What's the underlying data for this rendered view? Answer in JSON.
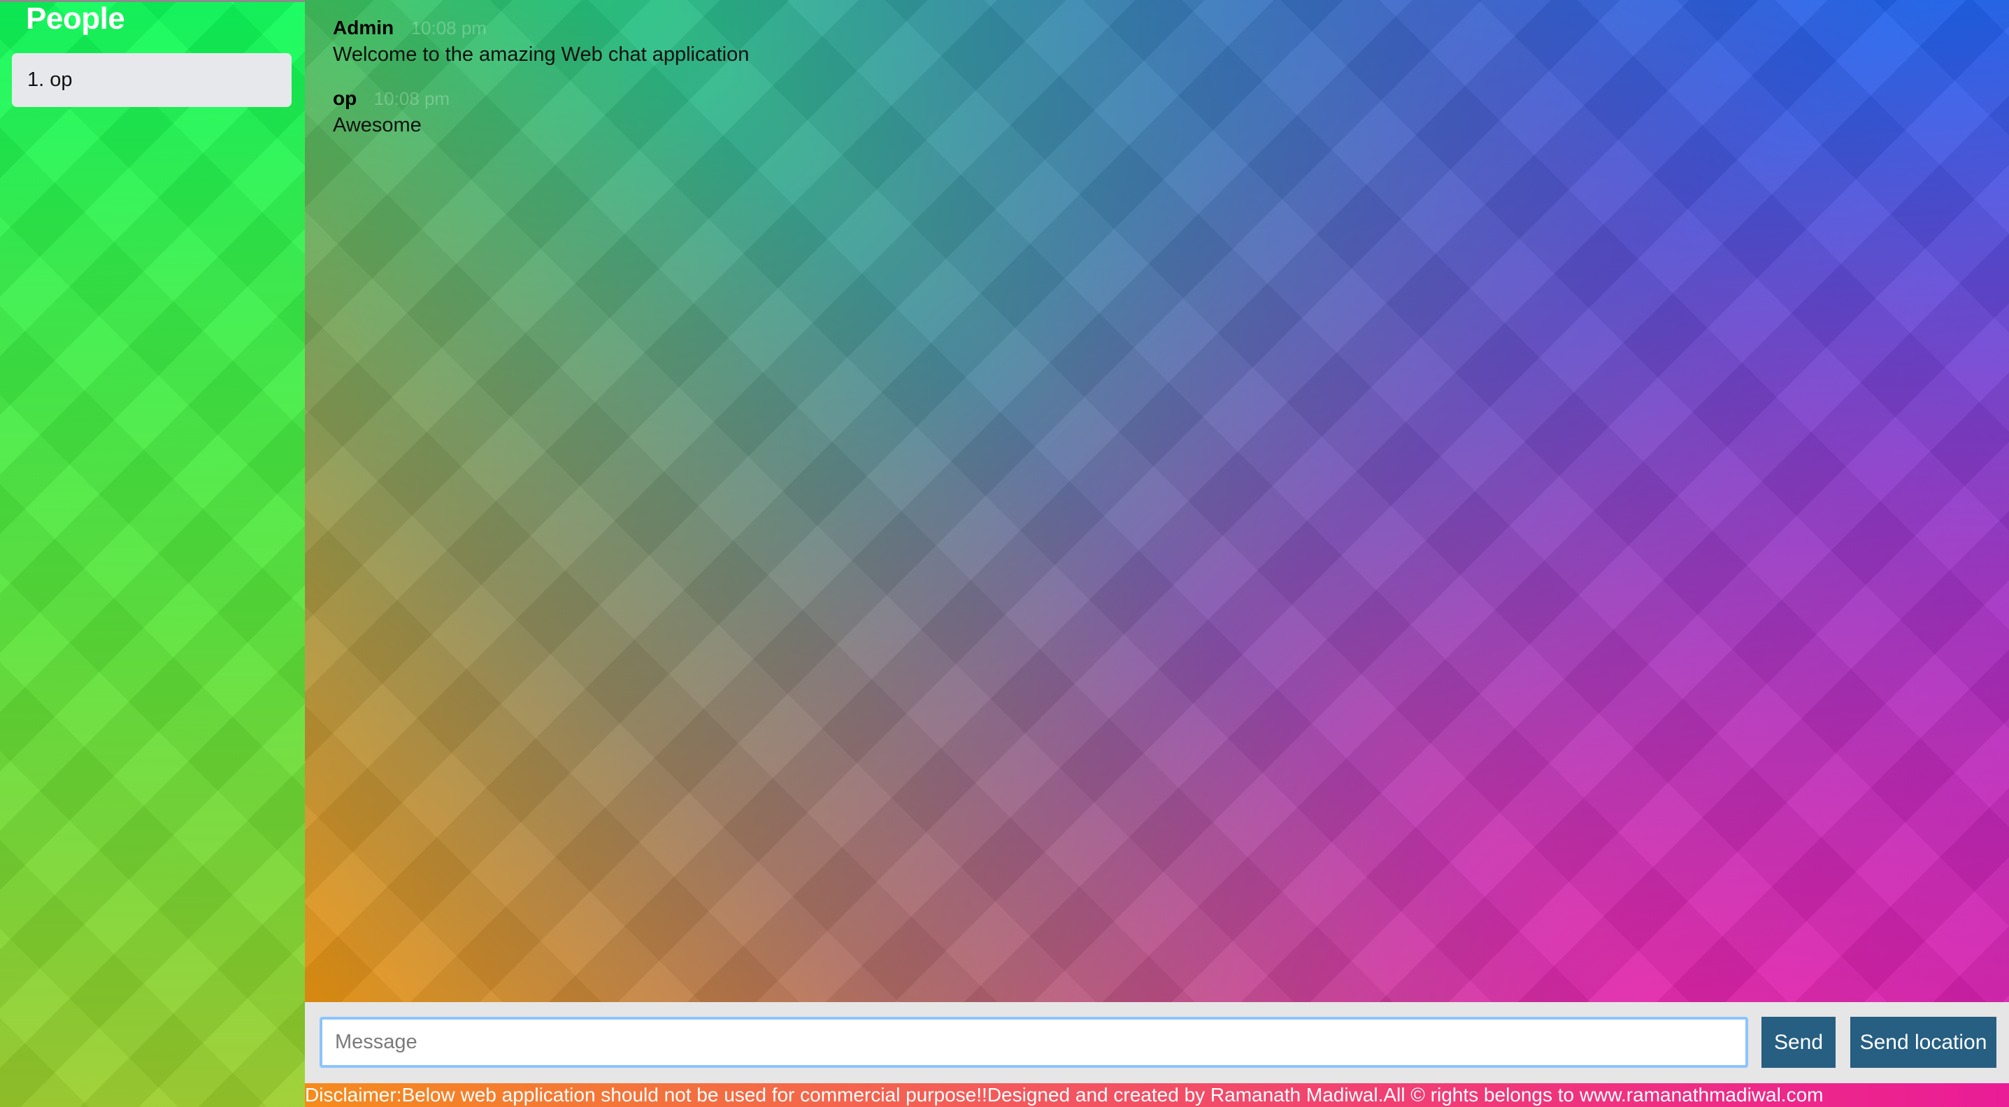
{
  "sidebar": {
    "title": "People",
    "people": [
      "1. op"
    ]
  },
  "chat": {
    "messages": [
      {
        "author": "Admin",
        "time": "10:08 pm",
        "text": "Welcome to the amazing Web chat application"
      },
      {
        "author": "op",
        "time": "10:08 pm",
        "text": "Awesome"
      }
    ]
  },
  "form": {
    "message_placeholder": "Message",
    "message_value": "",
    "send_label": "Send",
    "send_location_label": "Send location"
  },
  "footer": {
    "disclaimer": "Disclaimer:Below web application should not be used for commercial purpose!!Designed and created by Ramanath Madiwal.All © rights belongs to www.ramanathmadiwal.com"
  },
  "colors": {
    "button": "#265f82",
    "input_focus_border": "#8cc4ff",
    "people_item_bg": "#e6e8ec",
    "footer_bg": "#e6e6e6"
  }
}
